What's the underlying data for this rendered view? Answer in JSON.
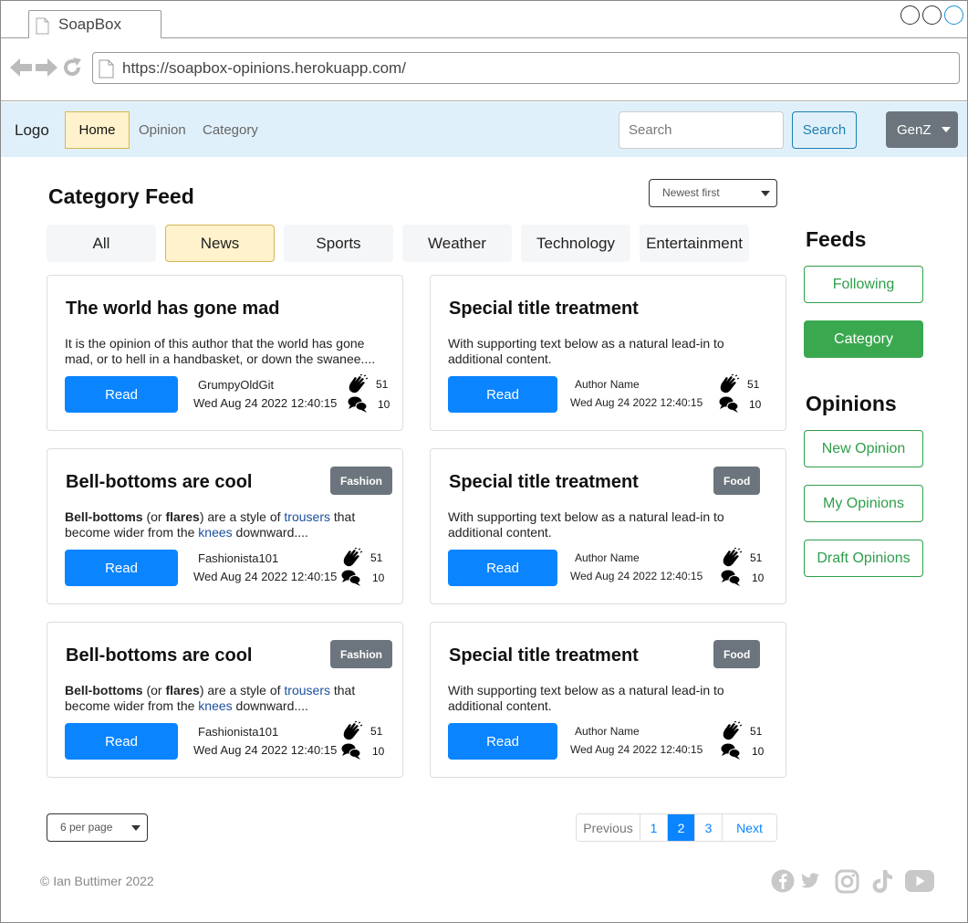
{
  "browser": {
    "tab_title": "SoapBox",
    "url": "https://soapbox-opinions.herokuapp.com/"
  },
  "navbar": {
    "logo": "Logo",
    "links": [
      "Home",
      "Opinion",
      "Category"
    ],
    "active_link": "Home",
    "search_placeholder": "Search",
    "search_button": "Search",
    "user_menu": "GenZ"
  },
  "main": {
    "title": "Category Feed",
    "sort": "Newest first",
    "category_tabs": [
      "All",
      "News",
      "Sports",
      "Weather",
      "Technology",
      "Entertainment"
    ],
    "active_category": "News",
    "cards": [
      {
        "title": "The world has gone mad",
        "text": "It is the opinion of this author that the world has gone mad, or to hell in a handbasket, or down the swanee....",
        "read": "Read",
        "author": "GrumpyOldGit",
        "date": "Wed Aug 24 2022 12:40:15",
        "claps": "51",
        "comments": "10"
      },
      {
        "title": "Special title treatment",
        "text": "With supporting text below as a natural lead-in to additional content.",
        "read": "Read",
        "author": "Author Name",
        "date": "Wed Aug 24 2022 12:40:15",
        "claps": "51",
        "comments": "10"
      },
      {
        "title": "Bell-bottoms are cool",
        "badge": "Fashion",
        "text_parts": [
          "Bell-bottoms",
          " (or ",
          "flares",
          ") are a style of ",
          "trousers",
          " that become wider from the ",
          "knees",
          " downward...."
        ],
        "read": "Read",
        "author": "Fashionista101",
        "date": "Wed Aug 24 2022 12:40:15",
        "claps": "51",
        "comments": "10"
      },
      {
        "title": "Special title treatment",
        "badge": "Food",
        "text": "With supporting text below as a natural lead-in to additional content.",
        "read": "Read",
        "author": "Author Name",
        "date": "Wed Aug 24 2022 12:40:15",
        "claps": "51",
        "comments": "10"
      },
      {
        "title": "Bell-bottoms are cool",
        "badge": "Fashion",
        "text_parts": [
          "Bell-bottoms",
          " (or ",
          "flares",
          ") are a style of ",
          "trousers",
          " that become wider from the ",
          "knees",
          " downward...."
        ],
        "read": "Read",
        "author": "Fashionista101",
        "date": "Wed Aug 24 2022 12:40:15",
        "claps": "51",
        "comments": "10"
      },
      {
        "title": "Special title treatment",
        "badge": "Food",
        "text": "With supporting text below as a natural lead-in to additional content.",
        "read": "Read",
        "author": "Author Name",
        "date": "Wed Aug 24 2022 12:40:15",
        "claps": "51",
        "comments": "10"
      }
    ],
    "per_page": "6 per page",
    "pagination": [
      "Previous",
      "1",
      "2",
      "3",
      "Next"
    ],
    "current_page": "2"
  },
  "sidebar": {
    "feeds_heading": "Feeds",
    "feeds": [
      "Following",
      "Category"
    ],
    "active_feed": "Category",
    "opinions_heading": "Opinions",
    "opinions": [
      "New Opinion",
      "My Opinions",
      "Draft Opinions"
    ]
  },
  "footer": {
    "copyright": "© Ian Buttimer 2022",
    "social_icons": [
      "facebook-icon",
      "twitter-icon",
      "instagram-icon",
      "tiktok-icon",
      "youtube-icon"
    ]
  },
  "colors": {
    "navbar_bg": "#e0f0fa",
    "active_highlight": "#fff2cc",
    "primary": "#0a84ff",
    "success": "#3aa84f",
    "badge": "#6c757d"
  }
}
